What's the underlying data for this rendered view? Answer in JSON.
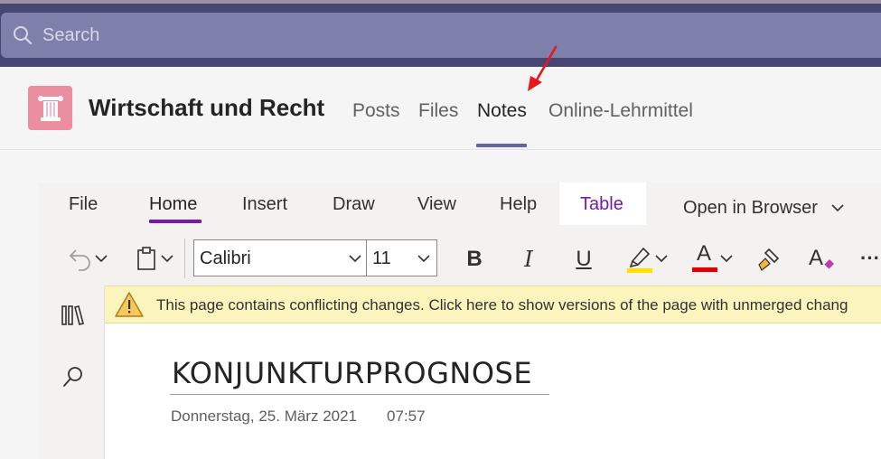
{
  "search": {
    "placeholder": "Search"
  },
  "team": {
    "name": "Wirtschaft und Recht",
    "tabs": [
      {
        "label": "Posts"
      },
      {
        "label": "Files"
      },
      {
        "label": "Notes"
      },
      {
        "label": "Online-Lehrmittel"
      }
    ]
  },
  "ribbon": {
    "menu": [
      "File",
      "Home",
      "Insert",
      "Draw",
      "View",
      "Help"
    ],
    "table_tab": "Table",
    "open_in_browser": "Open in Browser",
    "font_name": "Calibri",
    "font_size": "11",
    "bold": "B",
    "italic": "I",
    "underline": "U",
    "font_color": "A",
    "more": "···",
    "colors": {
      "highlight": "#ffe000",
      "font_color": "#e00000",
      "accent": "#7719aa"
    }
  },
  "warning": {
    "text": "This page contains conflicting changes. Click here to show versions of the page with unmerged chang"
  },
  "page": {
    "title": "KONJUNKTURPROGNOSE",
    "date": "Donnerstag, 25. März 2021",
    "time": "07:57"
  },
  "icons": [
    "search-icon",
    "pillar-icon",
    "undo-icon",
    "clipboard-icon",
    "highlighter-icon",
    "format-painter-icon",
    "clear-formatting-icon",
    "notebooks-icon",
    "search-icon",
    "warning-icon"
  ]
}
